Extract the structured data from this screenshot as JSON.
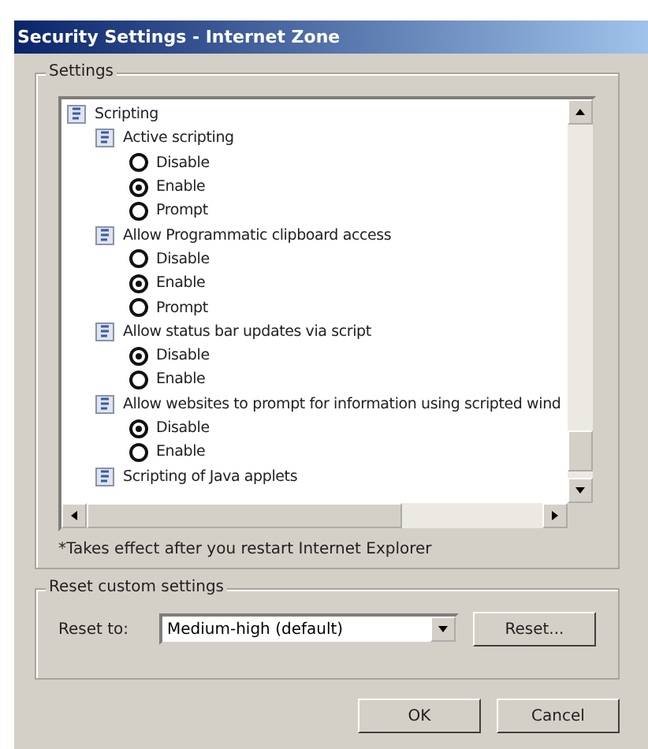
{
  "window": {
    "title": "Security Settings - Internet Zone"
  },
  "settings_group": {
    "label": "Settings",
    "tree": [
      {
        "label": "Scripting",
        "children": [
          {
            "label": "Active scripting",
            "options": [
              {
                "label": "Disable",
                "selected": false
              },
              {
                "label": "Enable",
                "selected": true
              },
              {
                "label": "Prompt",
                "selected": false
              }
            ]
          },
          {
            "label": "Allow Programmatic clipboard access",
            "options": [
              {
                "label": "Disable",
                "selected": false
              },
              {
                "label": "Enable",
                "selected": true
              },
              {
                "label": "Prompt",
                "selected": false
              }
            ]
          },
          {
            "label": "Allow status bar updates via script",
            "options": [
              {
                "label": "Disable",
                "selected": true
              },
              {
                "label": "Enable",
                "selected": false
              }
            ]
          },
          {
            "label": "Allow websites to prompt for information using scripted wind",
            "options": [
              {
                "label": "Disable",
                "selected": true
              },
              {
                "label": "Enable",
                "selected": false
              }
            ]
          },
          {
            "label": "Scripting of Java applets"
          }
        ]
      }
    ],
    "footnote": "*Takes effect after you restart Internet Explorer"
  },
  "reset_group": {
    "label": "Reset custom settings",
    "field_label": "Reset to:",
    "value": "Medium-high (default)",
    "button": "Reset..."
  },
  "buttons": [
    "OK",
    "Cancel"
  ]
}
